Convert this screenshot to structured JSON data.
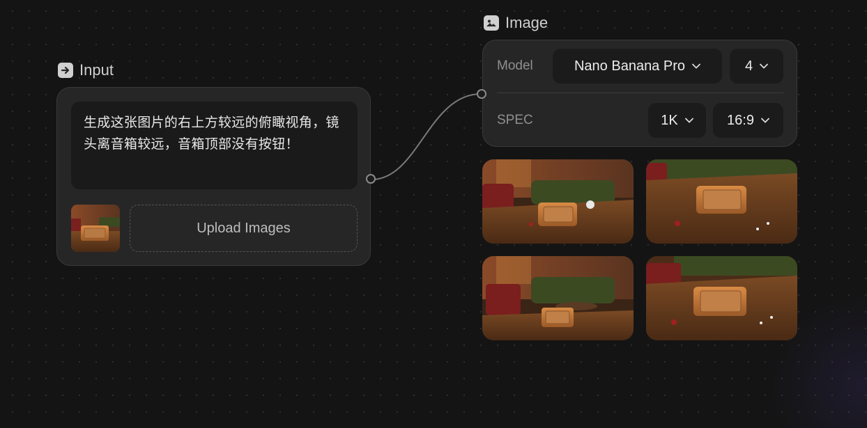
{
  "input_node": {
    "title": "Input",
    "prompt": "生成这张图片的右上方较远的俯瞰视角，镜头离音箱较远，音箱顶部没有按钮！",
    "upload_label": "Upload Images",
    "thumbnail_alt": "wooden speaker on table reference image"
  },
  "image_node": {
    "title": "Image",
    "model_label": "Model",
    "model_value": "Nano Banana Pro",
    "count_value": "4",
    "spec_label": "SPEC",
    "resolution_value": "1K",
    "aspect_value": "16:9",
    "results": [
      "generated image 1",
      "generated image 2",
      "generated image 3",
      "generated image 4"
    ]
  },
  "colors": {
    "background": "#141414",
    "card": "#262626",
    "field": "#1b1b1b",
    "wood": "#b06a33",
    "sofa": "#3c4a22"
  },
  "icons": [
    "arrow-right-box-icon",
    "image-icon",
    "chevron-down-icon"
  ]
}
